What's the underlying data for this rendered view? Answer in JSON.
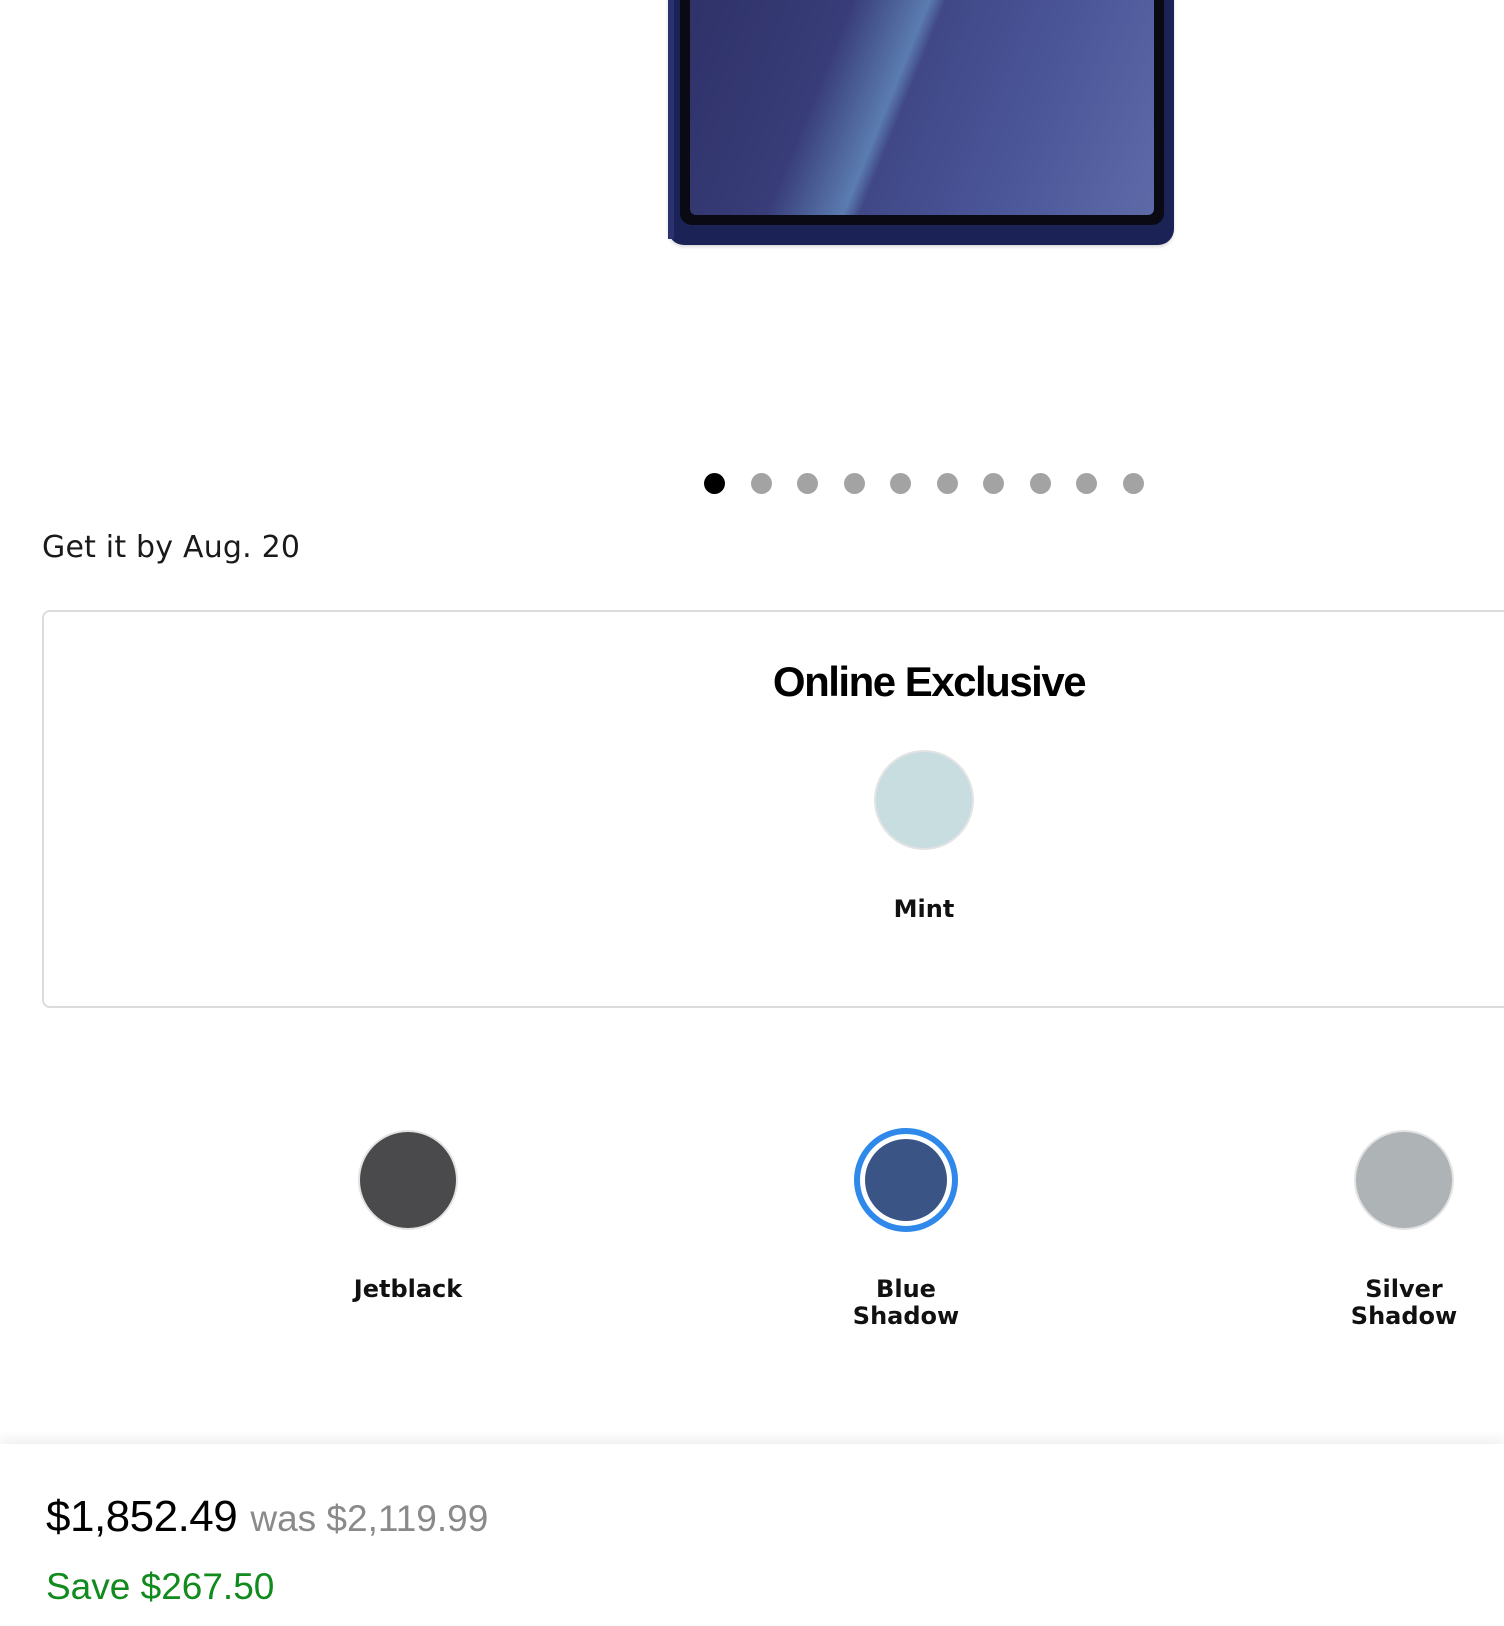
{
  "product": {
    "image_alt": "",
    "carousel": {
      "total": 10,
      "active_index": 0
    }
  },
  "delivery": {
    "text": "Get it by Aug. 20"
  },
  "online_exclusive": {
    "title": "Online Exclusive",
    "colors": [
      {
        "name": "Mint",
        "hex": "#c8dde0"
      }
    ]
  },
  "colors": [
    {
      "name": "Jetblack",
      "hex": "#4a4a4c",
      "selected": false
    },
    {
      "name": "Blue Shadow",
      "hex": "#3a5585",
      "selected": true
    },
    {
      "name": "Silver Shadow",
      "hex": "#aeb4b6",
      "selected": false
    }
  ],
  "pricing": {
    "current": "$1,852.49",
    "was": "was $2,119.99",
    "save": "Save $267.50"
  },
  "theme": {
    "selected_ring": "#2e89ea",
    "save_color": "#118a1e"
  }
}
